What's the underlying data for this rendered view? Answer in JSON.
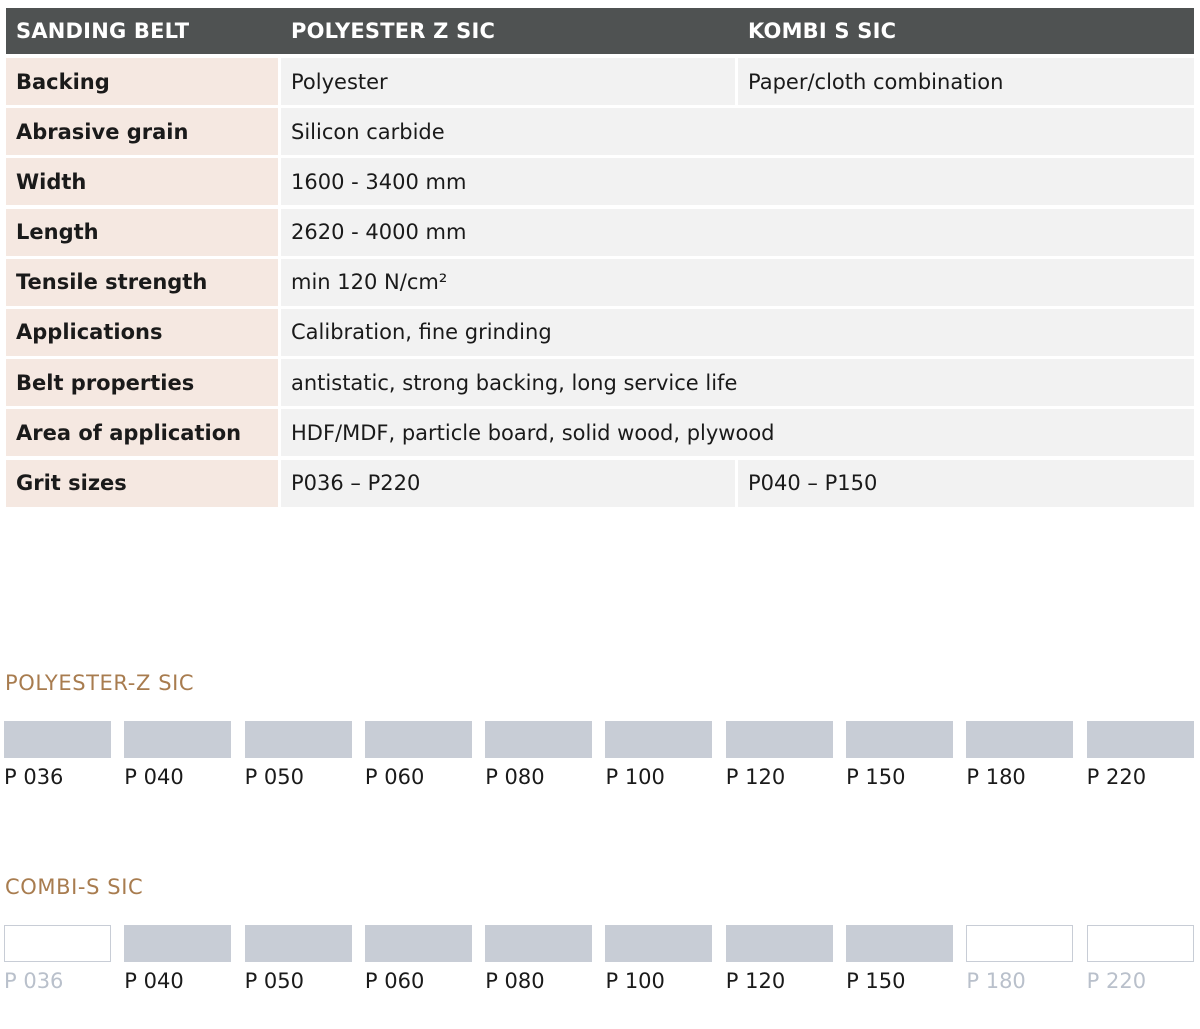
{
  "table": {
    "header": [
      "SANDING BELT",
      "POLYESTER Z SIC",
      "KOMBI S SIC"
    ],
    "rows": [
      {
        "label": "Backing",
        "v1": "Polyester",
        "v2": "Paper/cloth combination"
      },
      {
        "label": "Abrasive grain",
        "v": "Silicon carbide"
      },
      {
        "label": "Width",
        "v": "1600 - 3400 mm"
      },
      {
        "label": "Length",
        "v": "2620 - 4000 mm"
      },
      {
        "label": "Tensile strength",
        "v": "min 120 N/cm²"
      },
      {
        "label": "Applications",
        "v": "Calibration, fine grinding"
      },
      {
        "label": "Belt properties",
        "v": "antistatic, strong backing, long service life"
      },
      {
        "label": "Area of application",
        "v": "HDF/MDF, particle board, solid wood, plywood"
      },
      {
        "label": "Grit sizes",
        "v1": "P036 – P220",
        "v2": "P040 – P150"
      }
    ]
  },
  "polyester": {
    "title": "POLYESTER-Z SIC",
    "grits": [
      {
        "label": "P 036",
        "available": true
      },
      {
        "label": "P 040",
        "available": true
      },
      {
        "label": "P 050",
        "available": true
      },
      {
        "label": "P 060",
        "available": true
      },
      {
        "label": "P 080",
        "available": true
      },
      {
        "label": "P 100",
        "available": true
      },
      {
        "label": "P 120",
        "available": true
      },
      {
        "label": "P 150",
        "available": true
      },
      {
        "label": "P 180",
        "available": true
      },
      {
        "label": "P 220",
        "available": true
      }
    ]
  },
  "combi": {
    "title": "COMBI-S SIC",
    "grits": [
      {
        "label": "P 036",
        "available": false
      },
      {
        "label": "P 040",
        "available": true
      },
      {
        "label": "P 050",
        "available": true
      },
      {
        "label": "P 060",
        "available": true
      },
      {
        "label": "P 080",
        "available": true
      },
      {
        "label": "P 100",
        "available": true
      },
      {
        "label": "P 120",
        "available": true
      },
      {
        "label": "P 150",
        "available": true
      },
      {
        "label": "P 180",
        "available": false
      },
      {
        "label": "P 220",
        "available": false
      }
    ]
  },
  "colors": {
    "header_bg": "#4f5252",
    "label_bg": "#f5e8e1",
    "value_bg": "#f2f2f2",
    "section_title": "#a87c4f",
    "swatch_on": "#c8cdd6",
    "label_off": "#b9c0cb"
  }
}
